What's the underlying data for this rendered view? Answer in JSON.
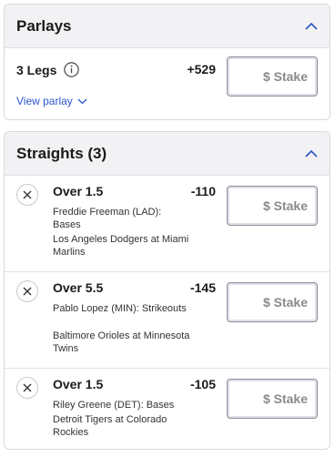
{
  "parlays": {
    "title": "Parlays",
    "legs_label": "3 Legs",
    "odds": "+529",
    "view_link": "View parlay",
    "stake_placeholder": "$ Stake"
  },
  "straights": {
    "title": "Straights (3)",
    "bets": [
      {
        "pick": "Over 1.5",
        "odds": "-110",
        "player": "Freddie Freeman (LAD): Bases",
        "game": "Los Angeles Dodgers at Miami Marlins",
        "stake_placeholder": "$ Stake"
      },
      {
        "pick": "Over 5.5",
        "odds": "-145",
        "player": "Pablo Lopez (MIN): Strikeouts",
        "game": "Baltimore Orioles at Minnesota Twins",
        "stake_placeholder": "$ Stake"
      },
      {
        "pick": "Over 1.5",
        "odds": "-105",
        "player": "Riley Greene (DET): Bases",
        "game": "Detroit Tigers at Colorado Rockies",
        "stake_placeholder": "$ Stake"
      }
    ]
  },
  "colors": {
    "accent": "#2b54c7",
    "header_bg": "#f2f2f4"
  },
  "icons": {
    "collapse": "chevron-up-icon",
    "info": "info-icon",
    "expand": "chevron-down-icon",
    "remove": "close-icon"
  }
}
